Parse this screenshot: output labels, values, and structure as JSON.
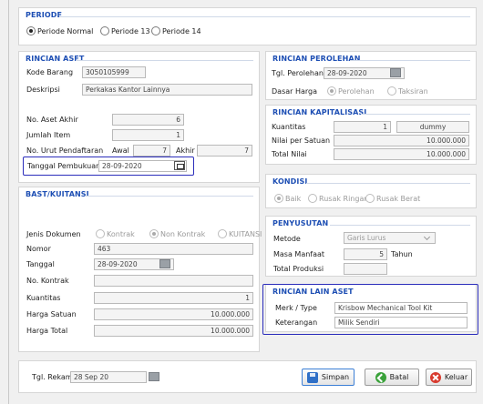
{
  "periode": {
    "title": "PERIODE",
    "options": [
      "Periode Normal",
      "Periode 13",
      "Periode 14"
    ],
    "selected": "Periode Normal"
  },
  "rincian_aset": {
    "title": "RINCIAN ASET",
    "kode_barang_label": "Kode Barang",
    "kode_barang_value": "3050105999",
    "deskripsi_label": "Deskripsi",
    "deskripsi_value": "Perkakas Kantor Lainnya",
    "no_aset_akhir_label": "No. Aset Akhir",
    "no_aset_akhir_value": "6",
    "jumlah_item_label": "Jumlah Item",
    "jumlah_item_value": "1",
    "no_urut_label": "No. Urut Pendaftaran",
    "awal_label": "Awal",
    "awal_value": "7",
    "akhir_label": "Akhir",
    "akhir_value": "7",
    "tanggal_pembukuan_label": "Tanggal Pembukuan",
    "tanggal_pembukuan_value": "28-09-2020"
  },
  "bast": {
    "title": "BAST/KUITANSI",
    "jenis_dokumen_label": "Jenis Dokumen",
    "jenis_options": [
      "Kontrak",
      "Non Kontrak",
      "KUITANSI"
    ],
    "jenis_selected": "Non Kontrak",
    "nomor_label": "Nomor",
    "nomor_value": "463",
    "tanggal_label": "Tanggal",
    "tanggal_value": "28-09-2020",
    "no_kontrak_label": "No. Kontrak",
    "no_kontrak_value": "",
    "kuantitas_label": "Kuantitas",
    "kuantitas_value": "1",
    "harga_satuan_label": "Harga Satuan",
    "harga_satuan_value": "10.000.000",
    "harga_total_label": "Harga Total",
    "harga_total_value": "10.000.000"
  },
  "rincian_perolehan": {
    "title": "RINCIAN PEROLEHAN",
    "tgl_perolehan_label": "Tgl. Perolehan",
    "tgl_perolehan_value": "28-09-2020",
    "dasar_harga_label": "Dasar Harga",
    "dasar_options": [
      "Perolehan",
      "Taksiran"
    ],
    "dasar_selected": "Perolehan"
  },
  "rincian_kapitalisasi": {
    "title": "RINCIAN KAPITALISASI",
    "kuantitas_label": "Kuantitas",
    "kuantitas_value": "1",
    "satuan_value": "dummy",
    "nilai_per_satuan_label": "Nilai per Satuan",
    "nilai_per_satuan_value": "10.000.000",
    "total_nilai_label": "Total Nilai",
    "total_nilai_value": "10.000.000"
  },
  "kondisi": {
    "title": "KONDISI",
    "options": [
      "Baik",
      "Rusak Ringan",
      "Rusak Berat"
    ],
    "selected": "Baik"
  },
  "penyusutan": {
    "title": "PENYUSUTAN",
    "metode_label": "Metode",
    "metode_value": "Garis Lurus",
    "masa_manfaat_label": "Masa Manfaat",
    "masa_manfaat_value": "5",
    "tahun_label": "Tahun",
    "total_produksi_label": "Total Produksi",
    "total_produksi_value": ""
  },
  "rincian_lain": {
    "title": "RINCIAN LAIN ASET",
    "merk_label": "Merk / Type",
    "merk_value": "Krisbow Mechanical Tool Kit",
    "keterangan_label": "Keterangan",
    "keterangan_value": "Milik Sendiri"
  },
  "footer": {
    "tgl_rekam_label": "Tgl. Rekam",
    "tgl_rekam_value": "28 Sep 20",
    "simpan_label": "Simpan",
    "batal_label": "Batal",
    "keluar_label": "Keluar"
  },
  "colors": {
    "title": "#1e4fb4",
    "highlight": "#2b2dbb"
  }
}
